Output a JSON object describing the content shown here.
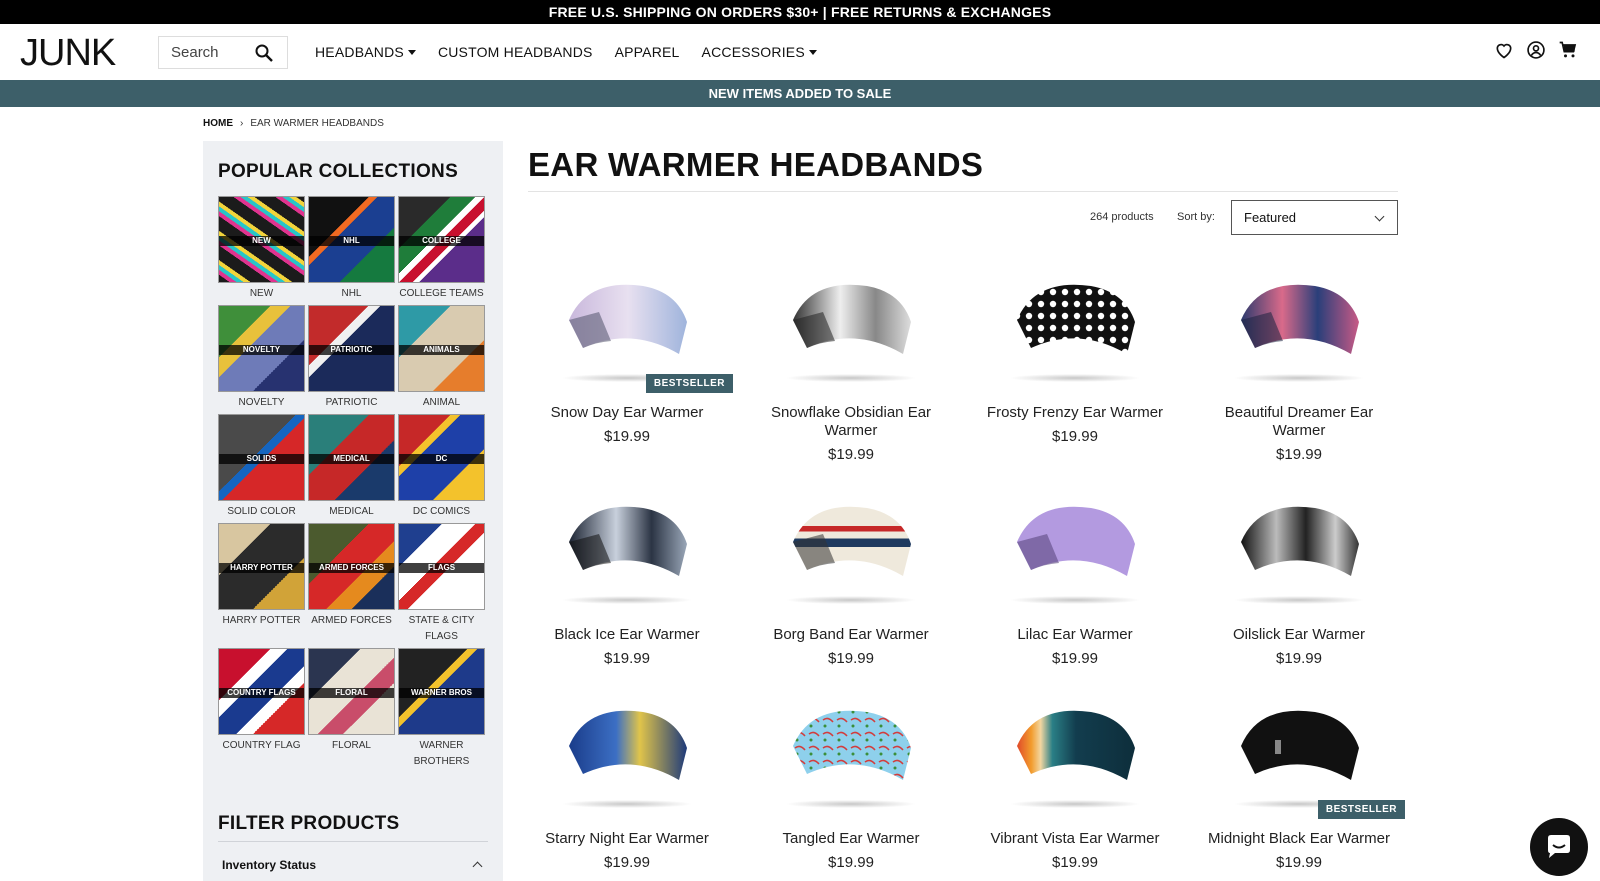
{
  "announcement": "FREE U.S. SHIPPING ON ORDERS $30+ | FREE RETURNS & EXCHANGES",
  "header": {
    "brand": "JUNK",
    "search_placeholder": "Search",
    "nav": [
      {
        "label": "HEADBANDS",
        "dropdown": true
      },
      {
        "label": "CUSTOM HEADBANDS",
        "dropdown": false
      },
      {
        "label": "APPAREL",
        "dropdown": false
      },
      {
        "label": "ACCESSORIES",
        "dropdown": true
      }
    ],
    "icons": [
      "heart-icon",
      "account-icon",
      "cart-icon"
    ]
  },
  "promo": "NEW ITEMS ADDED TO SALE",
  "breadcrumb": {
    "home": "HOME",
    "separator": "›",
    "current": "EAR WARMER HEADBANDS"
  },
  "sidebar": {
    "title": "POPULAR COLLECTIONS",
    "collections": [
      {
        "badge": "NEW",
        "caption": "NEW"
      },
      {
        "badge": "NHL",
        "caption": "NHL"
      },
      {
        "badge": "COLLEGE",
        "caption": "COLLEGE TEAMS"
      },
      {
        "badge": "NOVELTY",
        "caption": "NOVELTY"
      },
      {
        "badge": "PATRIOTIC",
        "caption": "PATRIOTIC"
      },
      {
        "badge": "ANIMALS",
        "caption": "ANIMAL"
      },
      {
        "badge": "SOLIDS",
        "caption": "SOLID COLOR"
      },
      {
        "badge": "MEDICAL",
        "caption": "MEDICAL"
      },
      {
        "badge": "DC",
        "caption": "DC COMICS"
      },
      {
        "badge": "HARRY POTTER",
        "caption": "HARRY POTTER"
      },
      {
        "badge": "ARMED FORCES",
        "caption": "ARMED FORCES"
      },
      {
        "badge": "FLAGS",
        "caption": "STATE & CITY FLAGS"
      },
      {
        "badge": "COUNTRY FLAGS",
        "caption": "COUNTRY FLAG"
      },
      {
        "badge": "FLORAL",
        "caption": "FLORAL"
      },
      {
        "badge": "WARNER BROS",
        "caption": "WARNER BROTHERS"
      }
    ],
    "filter_title": "FILTER PRODUCTS",
    "filter_group": "Inventory Status"
  },
  "main": {
    "title": "EAR WARMER HEADBANDS",
    "product_count": "264 products",
    "sort_label": "Sort by:",
    "sort_value": "Featured",
    "products": [
      {
        "name": "Snow Day Ear Warmer",
        "price": "$19.99",
        "badge": "BESTSELLER"
      },
      {
        "name": "Snowflake Obsidian Ear Warmer",
        "price": "$19.99",
        "badge": ""
      },
      {
        "name": "Frosty Frenzy Ear Warmer",
        "price": "$19.99",
        "badge": ""
      },
      {
        "name": "Beautiful Dreamer Ear Warmer",
        "price": "$19.99",
        "badge": ""
      },
      {
        "name": "Black Ice Ear Warmer",
        "price": "$19.99",
        "badge": ""
      },
      {
        "name": "Borg Band Ear Warmer",
        "price": "$19.99",
        "badge": ""
      },
      {
        "name": "Lilac Ear Warmer",
        "price": "$19.99",
        "badge": ""
      },
      {
        "name": "Oilslick Ear Warmer",
        "price": "$19.99",
        "badge": ""
      },
      {
        "name": "Starry Night Ear Warmer",
        "price": "$19.99",
        "badge": ""
      },
      {
        "name": "Tangled Ear Warmer",
        "price": "$19.99",
        "badge": ""
      },
      {
        "name": "Vibrant Vista Ear Warmer",
        "price": "$19.99",
        "badge": ""
      },
      {
        "name": "Midnight Black Ear Warmer",
        "price": "$19.99",
        "badge": "BESTSELLER"
      }
    ]
  },
  "colors": {
    "accent": "#3d5f69",
    "topbar": "#000000"
  }
}
